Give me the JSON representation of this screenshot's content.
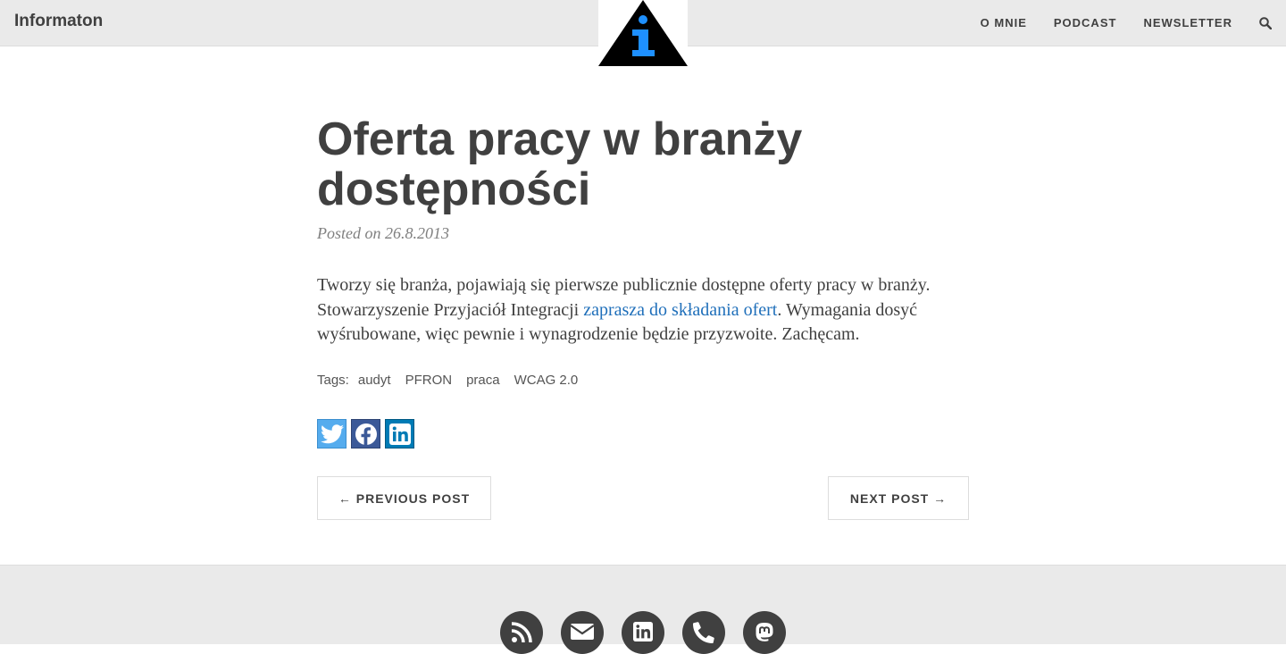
{
  "navbar": {
    "brand": "Informaton",
    "links": [
      "O MNIE",
      "PODCAST",
      "NEWSLETTER"
    ],
    "search_icon": "search-icon",
    "logo_icon": "info-triangle-logo",
    "logo_colors": {
      "triangle": "#000000",
      "letter": "#1e90ff"
    }
  },
  "post": {
    "title": "Oferta pracy w branży dostępności",
    "meta": "Posted on 26.8.2013",
    "body": {
      "text_before": "Tworzy się branża, pojawiają się pierwsze publicznie dostępne oferty pracy w branży. Stowarzyszenie Przyjaciół Integracji ",
      "link_text": "zaprasza do składania ofert",
      "text_after": ". Wymagania dosyć wyśrubowane, więc pewnie i wynagrodzenie będzie przyzwoite. Zachęcam."
    },
    "tags_label": "Tags:",
    "tags": [
      "audyt",
      "PFRON",
      "praca",
      "WCAG 2.0"
    ],
    "share": [
      {
        "icon": "twitter-icon",
        "color": "#55acee"
      },
      {
        "icon": "facebook-icon",
        "color": "#3b5998"
      },
      {
        "icon": "linkedin-icon",
        "color": "#007bb5"
      }
    ],
    "pager": {
      "previous": "← PREVIOUS POST",
      "next": "NEXT POST →"
    }
  },
  "footer": {
    "icons": [
      "rss-icon",
      "email-icon",
      "linkedin-icon",
      "phone-icon",
      "mastodon-icon"
    ]
  }
}
